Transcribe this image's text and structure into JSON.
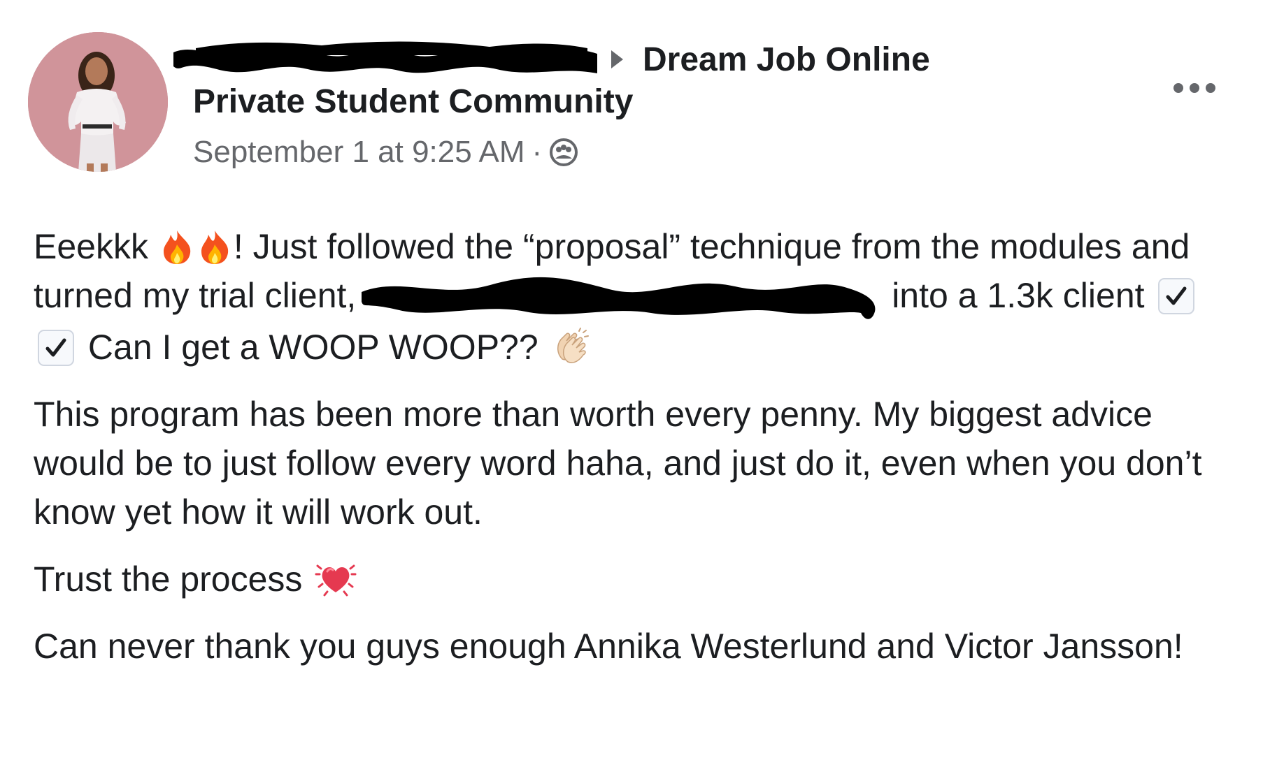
{
  "post": {
    "author": {
      "name_redacted": true
    },
    "group": {
      "name": "Dream Job Online",
      "subtitle": "Private Student Community"
    },
    "meta": {
      "timestamp": "September 1 at 9:25 AM",
      "separator": "·",
      "privacy_icon": "members-icon"
    },
    "more_icon": "more-options-icon",
    "body": {
      "p1": {
        "t1": "Eeekkk",
        "emoji1": "fire-emoji",
        "emoji2": "fire-emoji",
        "t2": "! Just followed the “proposal” technique from the modules and turned my trial client,",
        "t3": "into a 1.3k client",
        "emoji3": "check-mark-emoji",
        "emoji4": "check-mark-emoji",
        "t4": "Can I get a WOOP WOOP??",
        "emoji5": "clapping-hands-emoji"
      },
      "p2": "This program has been more than worth every penny. My biggest advice would be to just follow every word haha, and just do it, even when you don’t know yet how it will work out.",
      "p3": {
        "text": "Trust the process",
        "emoji": "beating-heart-emoji"
      },
      "p4": "Can never thank you guys enough Annika Westerlund and Victor Jansson!"
    },
    "colors": {
      "text": "#1c1e21",
      "secondary": "#65676b",
      "redaction": "#000000"
    }
  }
}
